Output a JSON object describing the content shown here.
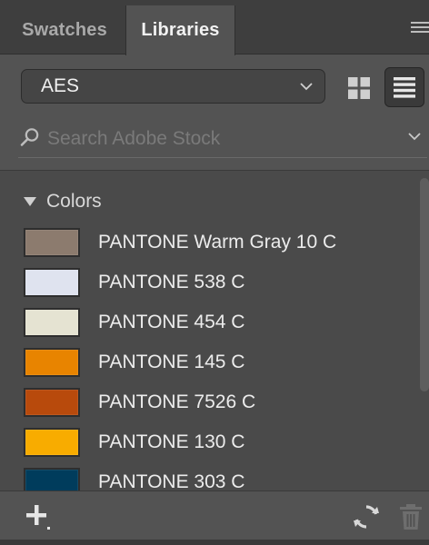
{
  "tabs": [
    {
      "label": "Swatches",
      "active": false
    },
    {
      "label": "Libraries",
      "active": true
    }
  ],
  "library": {
    "selected": "AES"
  },
  "view_modes": {
    "grid": "grid-view-icon",
    "list": "list-view-icon",
    "active": "list"
  },
  "search": {
    "placeholder": "Search Adobe Stock",
    "value": ""
  },
  "colors_section": {
    "title": "Colors",
    "expanded": true,
    "items": [
      {
        "name": "PANTONE Warm Gray 10 C",
        "color": "#8c7b6e"
      },
      {
        "name": "PANTONE 538 C",
        "color": "#dfe3ef"
      },
      {
        "name": "PANTONE 454 C",
        "color": "#e5e3d2"
      },
      {
        "name": "PANTONE 145 C",
        "color": "#e88400"
      },
      {
        "name": "PANTONE 7526 C",
        "color": "#b84a0c"
      },
      {
        "name": "PANTONE 130 C",
        "color": "#f8ac00"
      },
      {
        "name": "PANTONE 303 C",
        "color": "#003c5c"
      }
    ]
  },
  "bottom_toolbar": {
    "add": "plus-icon",
    "sync": "sync-icon",
    "delete": "trash-icon"
  },
  "theme": {
    "panel_bg": "#535353",
    "tab_bar_bg": "#3e3e3e",
    "content_bg": "#4a4a4a"
  }
}
